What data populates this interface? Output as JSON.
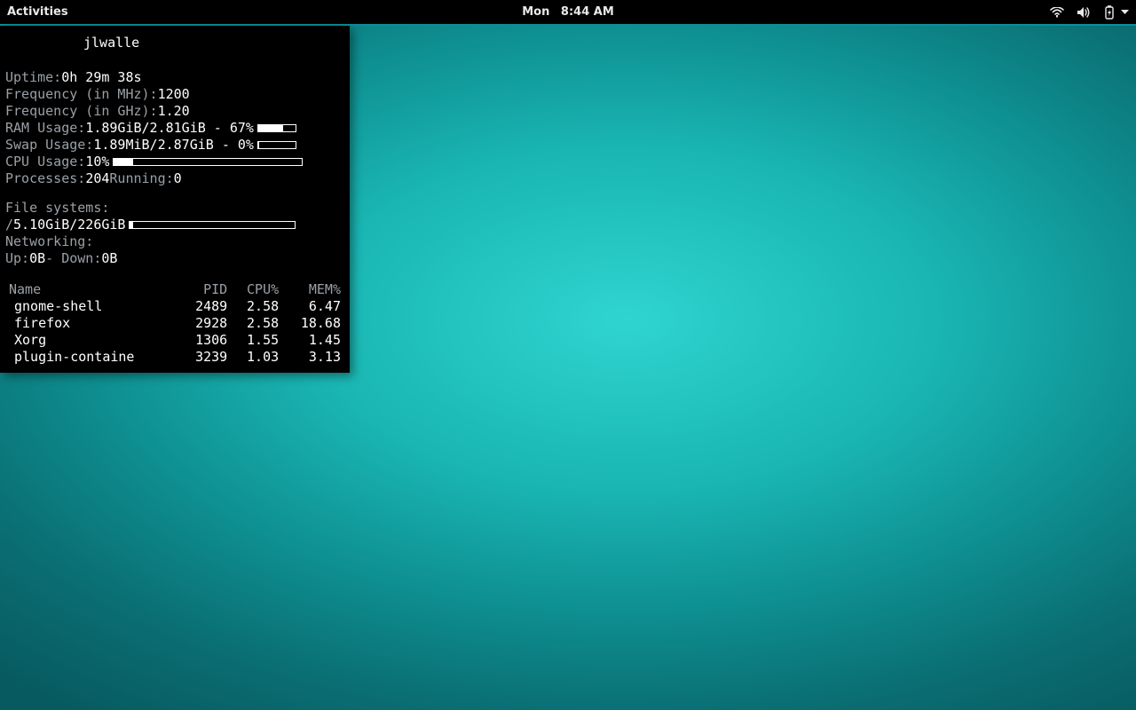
{
  "topbar": {
    "activities": "Activities",
    "clock_day": "Mon",
    "clock_time": "8:44 AM",
    "icons": [
      "wifi-icon",
      "volume-icon",
      "battery-icon",
      "caret-down-icon"
    ]
  },
  "conky": {
    "hostname": "jlwalle",
    "uptime_label": "Uptime: ",
    "uptime_value": "0h 29m 38s",
    "freq_mhz_label": "Frequency (in MHz): ",
    "freq_mhz_value": "1200",
    "freq_ghz_label": "Frequency (in GHz): ",
    "freq_ghz_value": "1.20",
    "ram_label": "RAM Usage: ",
    "ram_value": "1.89GiB/2.81GiB - 67%",
    "ram_pct": 67,
    "swap_label": "Swap Usage: ",
    "swap_value": "1.89MiB/2.87GiB - 0%",
    "swap_pct": 0,
    "cpu_label": "CPU Usage: ",
    "cpu_value": "10%",
    "cpu_pct": 10,
    "proc_label": "Processes: ",
    "proc_value": "204",
    "running_label": "  Running: ",
    "running_value": "0",
    "fs_heading": "File systems:",
    "fs_mount": " / ",
    "fs_value": "5.10GiB/226GiB",
    "fs_pct": 2,
    "net_heading": "Networking:",
    "net_up_label": "Up: ",
    "net_up_value": "0B",
    "net_down_label": "   - Down: ",
    "net_down_value": "0B",
    "table": {
      "headers": [
        "Name",
        "PID",
        "CPU%",
        "MEM%"
      ],
      "rows": [
        {
          "name": "gnome-shell",
          "pid": "2489",
          "cpu": "2.58",
          "mem": "6.47"
        },
        {
          "name": "firefox",
          "pid": "2928",
          "cpu": "2.58",
          "mem": "18.68"
        },
        {
          "name": "Xorg",
          "pid": "1306",
          "cpu": "1.55",
          "mem": "1.45"
        },
        {
          "name": "plugin-containe",
          "pid": "3239",
          "cpu": "1.03",
          "mem": "3.13"
        }
      ]
    }
  }
}
